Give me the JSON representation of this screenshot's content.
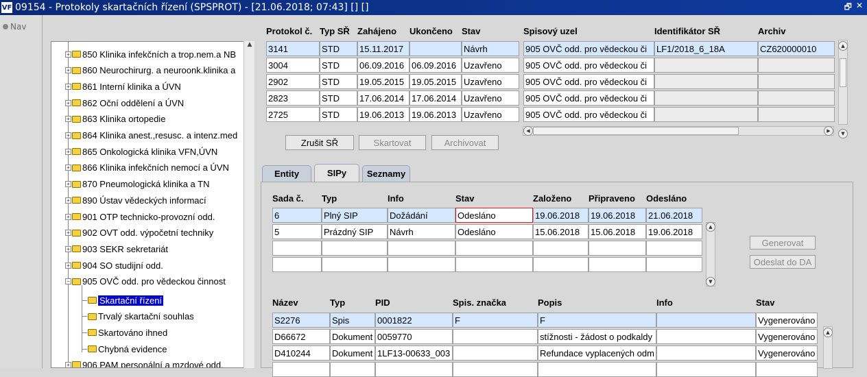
{
  "window": {
    "title": "09154 - Protokoly skartačních řízení (SPSPROT) - [21.06.2018; 07:43]  []  []",
    "icon_text": "VF",
    "restore_glyph": "🗗",
    "close_glyph": "✕"
  },
  "nav": {
    "label": "Nav"
  },
  "tree": {
    "items": [
      {
        "label": "850 Klinika infekčních a trop.nem.a NB",
        "expander": "+"
      },
      {
        "label": "860 Neurochirurg. a neuroonk.klinika a",
        "expander": "+"
      },
      {
        "label": "861 Interní klinika a ÚVN",
        "expander": "+"
      },
      {
        "label": "862 Oční oddělení a ÚVN",
        "expander": "+"
      },
      {
        "label": "863 Klinika ortopedie",
        "expander": "+"
      },
      {
        "label": "864 Klinika anest.,resusc. a intenz.med",
        "expander": "+"
      },
      {
        "label": "865 Onkologická klinika VFN,ÚVN",
        "expander": "+"
      },
      {
        "label": "866 Klinika infekčních nemocí a ÚVN",
        "expander": "+"
      },
      {
        "label": "870 Pneumologická klinika a TN",
        "expander": "+"
      },
      {
        "label": "890 Ústav vědeckých informací",
        "expander": "+"
      },
      {
        "label": "901 OTP technicko-provozní odd.",
        "expander": "+"
      },
      {
        "label": "902 OVT odd. výpočetní techniky",
        "expander": "+"
      },
      {
        "label": "903 SEKR sekretariát",
        "expander": "+"
      },
      {
        "label": "904 SO studijní odd.",
        "expander": "+"
      },
      {
        "label": "905 OVČ odd. pro vědeckou činnost",
        "expander": "−"
      }
    ],
    "children": [
      {
        "label": "Skartační řízení",
        "selected": true
      },
      {
        "label": "Trvalý skartační souhlas",
        "selected": false
      },
      {
        "label": "Skartováno ihned",
        "selected": false
      },
      {
        "label": "Chybná evidence",
        "selected": false
      }
    ],
    "last_item": {
      "label": "906 PAM personální a mzdové odd.",
      "expander": "+"
    }
  },
  "protocols": {
    "headers": [
      "Protokol č.",
      "Typ SŘ",
      "Zahájeno",
      "Ukončeno",
      "Stav",
      "Spisový uzel",
      "Identifikátor SŘ",
      "Archiv"
    ],
    "rows": [
      [
        "3141",
        "STD",
        "15.11.2017",
        "",
        "Návrh",
        "905 OVČ odd. pro vědeckou či",
        "LF1/2018_6_18A",
        "CZ620000010"
      ],
      [
        "3004",
        "STD",
        "06.09.2016",
        "06.09.2016",
        "Uzavřeno",
        "905 OVČ odd. pro vědeckou či",
        "",
        ""
      ],
      [
        "2902",
        "STD",
        "19.05.2015",
        "19.05.2015",
        "Uzavřeno",
        "905 OVČ odd. pro vědeckou či",
        "",
        ""
      ],
      [
        "2823",
        "STD",
        "17.06.2014",
        "17.06.2014",
        "Uzavřeno",
        "905 OVČ odd. pro vědeckou či",
        "",
        ""
      ],
      [
        "2725",
        "STD",
        "19.06.2013",
        "19.06.2013",
        "Uzavřeno",
        "905 OVČ odd. pro vědeckou či",
        "",
        ""
      ]
    ]
  },
  "actions": {
    "cancel": "Zrušit SŘ",
    "shred": "Skartovat",
    "archive": "Archivovat"
  },
  "tabs": [
    "Entity",
    "SIPy",
    "Seznamy"
  ],
  "sips": {
    "headers": [
      "Sada č.",
      "Typ",
      "Info",
      "Stav",
      "Založeno",
      "Připraveno",
      "Odesláno"
    ],
    "rows": [
      [
        "6",
        "Plný SIP",
        "Dožádání",
        "Odesláno",
        "19.06.2018",
        "19.06.2018",
        "21.06.2018"
      ],
      [
        "5",
        "Prázdný SIP",
        "Návrh",
        "Odesláno",
        "15.06.2018",
        "15.06.2018",
        "19.06.2018"
      ]
    ],
    "generate": "Generovat",
    "send": "Odeslat do DA"
  },
  "docs": {
    "headers": [
      "Název",
      "Typ",
      "PID",
      "Spis. značka",
      "Popis",
      "Info",
      "Stav"
    ],
    "rows": [
      [
        "S2276",
        "Spis",
        "0001822",
        "F",
        "F",
        "",
        "Vygenerováno"
      ],
      [
        "D66672",
        "Dokument",
        "0059770",
        "",
        "stížnosti - žádost o podkaldy",
        "",
        "Vygenerováno"
      ],
      [
        "D410244",
        "Dokument",
        "1LF13-00633_003",
        "",
        "Refundace vyplacených odm",
        "",
        "Vygenerováno"
      ]
    ]
  }
}
